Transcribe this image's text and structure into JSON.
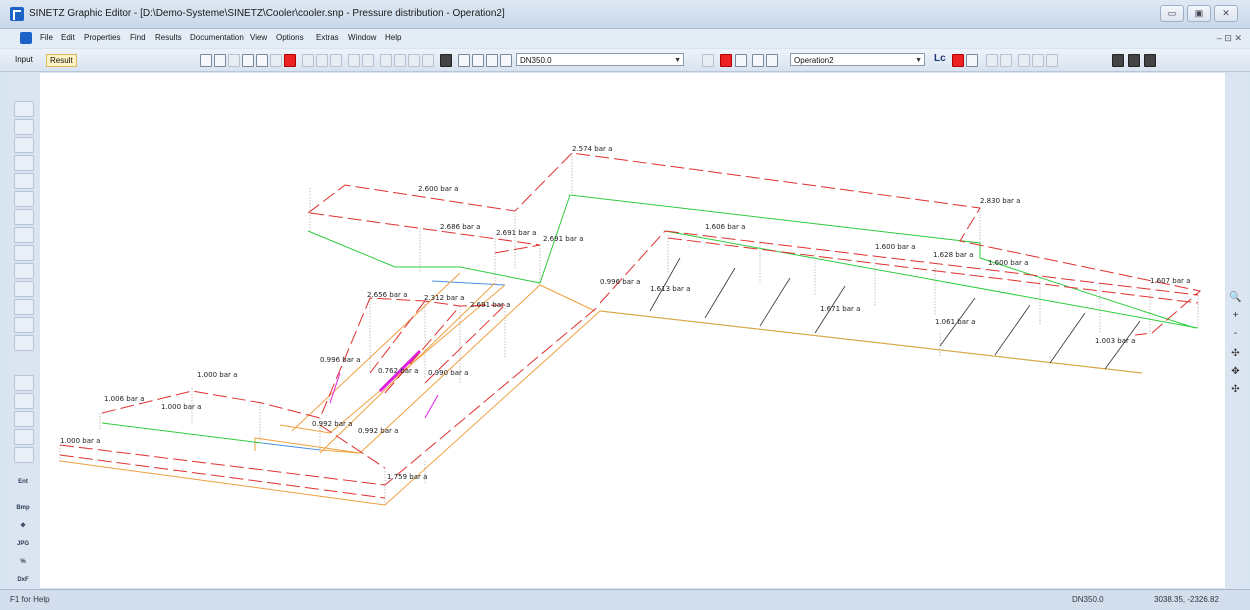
{
  "window": {
    "title": "SINETZ Graphic Editor - [D:\\Demo-Systeme\\SINETZ\\Cooler\\cooler.snp - Pressure distribution - Operation2]",
    "controls": [
      "▭",
      "▣",
      "✕"
    ]
  },
  "menu": {
    "items": [
      "File",
      "Edit",
      "Properties",
      "Find",
      "Results",
      "Documentation",
      "View",
      "Options",
      "Extras",
      "Window",
      "Help"
    ],
    "mdi_controls": "– ⊡ ✕"
  },
  "toolbar": {
    "mode_tabs": [
      "Input",
      "Result"
    ],
    "active_mode": "Result",
    "dn_combo": "DN350.0",
    "operation_combo": "Operation2",
    "lc_label": "Lc"
  },
  "left_tools": {
    "text_buttons": [
      "Ent",
      "Bmp",
      "✥",
      "JPG",
      "%",
      "DxF"
    ]
  },
  "right_tools": [
    "🔍",
    "+",
    "-",
    "✣",
    "✥",
    "✣"
  ],
  "diagram": {
    "pressure_labels": [
      "2.574 bar a",
      "2.830 bar a",
      "2.600 bar a",
      "2.686 bar a",
      "2.691 bar a",
      "2.691 bar a",
      "1.606 bar a",
      "1.600 bar a",
      "1.628 bar a",
      "1.600 bar a",
      "1.607 bar a",
      "0.996 bar a",
      "1.613 bar a",
      "1.671 bar a",
      "1.061 bar a",
      "1.003 bar a",
      "2.656 bar a",
      "2.312 bar a",
      "2.691 bar a",
      "0.996 bar a",
      "0.762 bar a",
      "0.990 bar a",
      "1.000 bar a",
      "1.006 bar a",
      "1.000 bar a",
      "1.000 bar a",
      "0.992 bar a",
      "0.992 bar a",
      "1.759 bar a"
    ],
    "colors": {
      "pressure": "#e03030",
      "pipe_green": "#2ecc40",
      "pipe_orange": "#f0a040",
      "pipe_blue": "#4a90e2",
      "pipe_magenta": "#e020e0",
      "pipe_dark": "#333333",
      "drop_line": "#888888"
    }
  },
  "status": {
    "help": "F1 for Help",
    "dn": "DN350.0",
    "coords": "3038.35, -2326.82"
  }
}
